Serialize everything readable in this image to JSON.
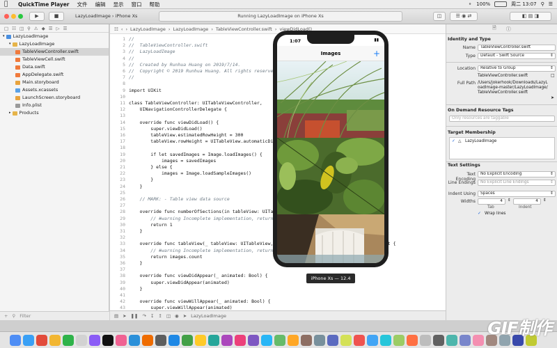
{
  "menubar": {
    "app_name": "QuickTime Player",
    "menus": [
      "文件",
      "编辑",
      "显示",
      "窗口",
      "帮助"
    ],
    "battery": "100%",
    "clock": "周二 13:07"
  },
  "toolbar": {
    "scheme": "LazyLoadImage",
    "device": "iPhone Xs",
    "activity": "Running LazyLoadImage on iPhone Xs"
  },
  "navigator": {
    "items": [
      {
        "label": "LazyLoadImage",
        "indent": 0,
        "kind": "project"
      },
      {
        "label": "LazyLoadImage",
        "indent": 1,
        "kind": "folder"
      },
      {
        "label": "TableViewController.swift",
        "indent": 2,
        "kind": "swift",
        "selected": true
      },
      {
        "label": "TableViewCell.swift",
        "indent": 2,
        "kind": "swift"
      },
      {
        "label": "Data.swift",
        "indent": 2,
        "kind": "swift"
      },
      {
        "label": "AppDelegate.swift",
        "indent": 2,
        "kind": "swift"
      },
      {
        "label": "Main.storyboard",
        "indent": 2,
        "kind": "storyboard"
      },
      {
        "label": "Assets.xcassets",
        "indent": 2,
        "kind": "assets"
      },
      {
        "label": "LaunchScreen.storyboard",
        "indent": 2,
        "kind": "storyboard"
      },
      {
        "label": "Info.plist",
        "indent": 2,
        "kind": "plist"
      },
      {
        "label": "Products",
        "indent": 1,
        "kind": "folder"
      }
    ],
    "filter_placeholder": "Filter"
  },
  "editor": {
    "jumpbar": [
      "LazyLoadImage",
      "LazyLoadImage",
      "TableViewController.swift",
      "viewDidLoad()"
    ],
    "lines": [
      {
        "n": "1",
        "t": "//",
        "c": "cm"
      },
      {
        "n": "2",
        "t": "//  TableViewController.swift",
        "c": "cm"
      },
      {
        "n": "3",
        "t": "//  LazyLoadImage",
        "c": "cm"
      },
      {
        "n": "4",
        "t": "//",
        "c": "cm"
      },
      {
        "n": "5",
        "t": "//  Created by Runhua Huang on 2019/7/14.",
        "c": "cm"
      },
      {
        "n": "6",
        "t": "//  Copyright © 2019 Runhua Huang. All rights reserved.",
        "c": "cm"
      },
      {
        "n": "7",
        "t": "//",
        "c": "cm"
      },
      {
        "n": "8",
        "t": "",
        "c": ""
      },
      {
        "n": "9",
        "t": "import UIKit",
        "c": "kwl"
      },
      {
        "n": "10",
        "t": "",
        "c": ""
      },
      {
        "n": "11",
        "t": "class TableViewController: UITableViewController,",
        "c": "kwl"
      },
      {
        "n": "12",
        "t": "    UINavigationControllerDelegate {",
        "c": "ty"
      },
      {
        "n": "13",
        "t": "",
        "c": ""
      },
      {
        "n": "14",
        "t": "    override func viewDidLoad() {",
        "c": "kwl"
      },
      {
        "n": "15",
        "t": "        super.viewDidLoad()",
        "c": "ty"
      },
      {
        "n": "16",
        "t": "        tableView.estimatedRowHeight = 300",
        "c": "ty"
      },
      {
        "n": "17",
        "t": "        tableView.rowHeight = UITableView.automaticDimension",
        "c": "ty"
      },
      {
        "n": "18",
        "t": "",
        "c": ""
      },
      {
        "n": "19",
        "t": "        if let savedImages = Image.loadImages() {",
        "c": "kwl"
      },
      {
        "n": "20",
        "t": "            images = savedImages",
        "c": ""
      },
      {
        "n": "21",
        "t": "        } else {",
        "c": "kwl"
      },
      {
        "n": "22",
        "t": "            images = Image.loadSampleImages()",
        "c": "ty"
      },
      {
        "n": "23",
        "t": "        }",
        "c": ""
      },
      {
        "n": "24",
        "t": "    }",
        "c": ""
      },
      {
        "n": "25",
        "t": "",
        "c": ""
      },
      {
        "n": "26",
        "t": "    // MARK: - Table view data source",
        "c": "cm"
      },
      {
        "n": "27",
        "t": "",
        "c": ""
      },
      {
        "n": "28",
        "t": "    override func numberOfSections(in tableView: UITableView) -> Int {",
        "c": "kwl"
      },
      {
        "n": "29",
        "t": "        // #warning Incomplete implementation, return the number of sections",
        "c": "cm"
      },
      {
        "n": "30",
        "t": "        return 1",
        "c": "kwl"
      },
      {
        "n": "31",
        "t": "    }",
        "c": ""
      },
      {
        "n": "32",
        "t": "",
        "c": ""
      },
      {
        "n": "33",
        "t": "    override func tableView(_ tableView: UITableView, numberOfRowsInSection section: Int) -> Int {",
        "c": "kwl"
      },
      {
        "n": "34",
        "t": "        // #warning Incomplete implementation, return the number of rows",
        "c": "cm"
      },
      {
        "n": "35",
        "t": "        return images.count",
        "c": "kwl"
      },
      {
        "n": "36",
        "t": "    }",
        "c": ""
      },
      {
        "n": "37",
        "t": "",
        "c": ""
      },
      {
        "n": "38",
        "t": "    override func viewDidAppear(_ animated: Bool) {",
        "c": "kwl"
      },
      {
        "n": "39",
        "t": "        super.viewDidAppear(animated)",
        "c": "ty"
      },
      {
        "n": "40",
        "t": "    }",
        "c": ""
      },
      {
        "n": "41",
        "t": "",
        "c": ""
      },
      {
        "n": "42",
        "t": "    override func viewWillAppear(_ animated: Bool) {",
        "c": "kwl"
      },
      {
        "n": "43",
        "t": "        super.viewWillAppear(animated)",
        "c": "ty"
      }
    ],
    "debug_target": "LazyLoadImage"
  },
  "inspector": {
    "identity_header": "Identity and Type",
    "name_label": "Name",
    "name_value": "TableViewController.swift",
    "type_label": "Type",
    "type_value": "Default - Swift Source",
    "location_label": "Location",
    "location_value": "Relative to Group",
    "location_file": "TableViewController.swift",
    "fullpath_label": "Full Path",
    "fullpath_value": "/Users/jokerhook/Downloads/LazyLoadImage-master/LazyLoadImage/TableViewController.swift",
    "ondemand_header": "On Demand Resource Tags",
    "ondemand_placeholder": "Only resources are taggable",
    "membership_header": "Target Membership",
    "membership_target": "LazyLoadImage",
    "text_header": "Text Settings",
    "encoding_label": "Text Encoding",
    "encoding_value": "No Explicit Encoding",
    "endings_label": "Line Endings",
    "endings_value": "No Explicit Line Endings",
    "indent_label": "Indent Using",
    "indent_value": "Spaces",
    "widths_label": "Widths",
    "tab_width": "4",
    "indent_width": "4",
    "tab_caption": "Tab",
    "indent_caption": "Indent",
    "wrap_label": "Wrap lines"
  },
  "simulator": {
    "time": "1:07",
    "title": "Images",
    "label": "iPhone Xs — 12.4"
  },
  "watermark": "GIF制作"
}
